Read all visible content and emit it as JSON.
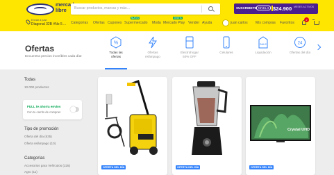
{
  "header": {
    "logo_line1": "mercado",
    "logo_line2": "libre",
    "search_placeholder": "Buscar productos, marcas y más…",
    "promo": {
      "label": "SUSCRIBETE",
      "level": "NIVEL 6",
      "price": "$24.900",
      "sub": "MESES ACTIVOS",
      "bg": "#4b1e8f"
    },
    "location_label": "Enviar a juan",
    "location_address": "Diagonal 32B #No 5 ...",
    "nav": [
      {
        "label": "Categorías"
      },
      {
        "label": "Ofertas"
      },
      {
        "label": "Cupones"
      },
      {
        "label": "Supermercado",
        "badge": "NUEVO"
      },
      {
        "label": "Moda"
      },
      {
        "label": "Mercado Play",
        "badge": "GRATIS"
      },
      {
        "label": "Vender"
      },
      {
        "label": "Ayuda"
      }
    ],
    "user_name": "juan carlos",
    "my_purchases": "Mis compras",
    "favorites": "Favoritos",
    "notifications_count": "2",
    "accent_color": "#ffe600"
  },
  "ofertas": {
    "title": "Ofertas",
    "subtitle": "Encuentra precios increíbles cada día!",
    "tabs": [
      {
        "label1": "Todas las",
        "label2": "ofertas",
        "icon": "percent-badge-icon",
        "active": true
      },
      {
        "label1": "Ofertas",
        "label2": "relámpago",
        "icon": "lightning-icon",
        "active": false
      },
      {
        "label1": "Electrohogar",
        "label2": "50% OFF",
        "icon": "appliance-icon",
        "active": false
      },
      {
        "label1": "Celulares",
        "label2": "",
        "icon": "phone-icon",
        "active": false
      },
      {
        "label1": "Liquidación",
        "label2": "",
        "icon": "sale-tag-icon",
        "active": false
      },
      {
        "label1": "Ofertas del día",
        "label2": "",
        "icon": "24h-clock-icon",
        "active": false
      }
    ]
  },
  "filters": {
    "all_title": "Todas",
    "all_count": "10.000 productos",
    "full_label": "FULL te ahorra envíos",
    "full_sub": "Con tu carrito de compras",
    "promo_title": "Tipo de promoción",
    "promo_items": [
      "Oferta del día (635)",
      "Oferta relámpago (10)"
    ],
    "cat_title": "Categorías",
    "cat_items": [
      "Accesorios para Vehículos (225)",
      "Agro (11)"
    ]
  },
  "products": [
    {
      "name": "pressure-washer",
      "badge": "OFERTA DEL DÍA"
    },
    {
      "name": "blender",
      "badge": "OFERTA DEL DÍA"
    },
    {
      "name": "crystal-uhd-tv",
      "badge": "OFERTA DEL DÍA",
      "brand_text": "Crystal UHD"
    }
  ]
}
